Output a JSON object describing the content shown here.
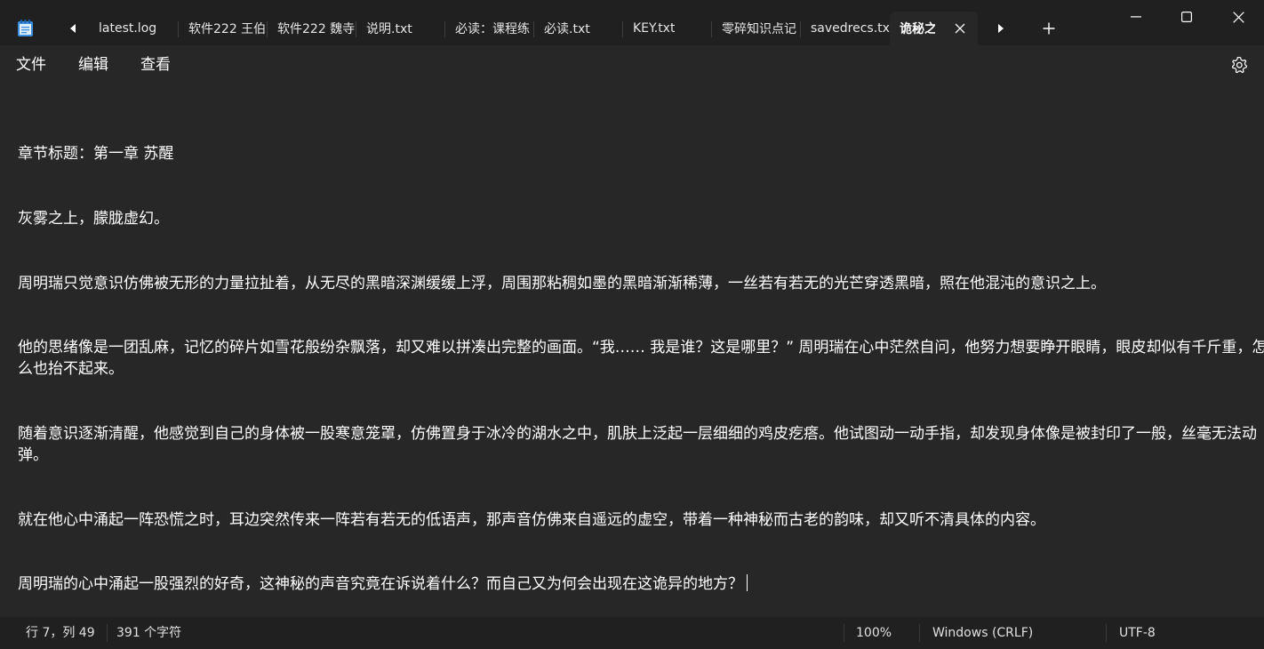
{
  "titlebar": {
    "tabs": [
      {
        "label": "latest.log"
      },
      {
        "label": "软件222 王伯"
      },
      {
        "label": "软件222 魏寺"
      },
      {
        "label": "说明.txt"
      },
      {
        "label": "必读：课程练"
      },
      {
        "label": "必读.txt"
      },
      {
        "label": "KEY.txt"
      },
      {
        "label": "零碎知识点记"
      },
      {
        "label": "savedrecs.txt"
      },
      {
        "label": "诡秘之"
      }
    ],
    "active_tab_index": 9
  },
  "menu": {
    "file": "文件",
    "edit": "编辑",
    "view": "查看"
  },
  "editor": {
    "lines": [
      "章节标题：第一章 苏醒",
      "灰雾之上，朦胧虚幻。",
      "周明瑞只觉意识仿佛被无形的力量拉扯着，从无尽的黑暗深渊缓缓上浮，周围那粘稠如墨的黑暗渐渐稀薄，一丝若有若无的光芒穿透黑暗，照在他混沌的意识之上。",
      "他的思绪像是一团乱麻，记忆的碎片如雪花般纷杂飘落，却又难以拼凑出完整的画面。“我…… 我是谁？这是哪里？” 周明瑞在心中茫然自问，他努力想要睁开眼睛，眼皮却似有千斤重，怎么也抬不起来。",
      "随着意识逐渐清醒，他感觉到自己的身体被一股寒意笼罩，仿佛置身于冰冷的湖水之中，肌肤上泛起一层细细的鸡皮疙瘩。他试图动一动手指，却发现身体像是被封印了一般，丝毫无法动弹。",
      "就在他心中涌起一阵恐慌之时，耳边突然传来一阵若有若无的低语声，那声音仿佛来自遥远的虚空，带着一种神秘而古老的韵味，却又听不清具体的内容。",
      "周明瑞的心中涌起一股强烈的好奇，这神秘的声音究竟在诉说着什么？而自己又为何会出现在这诡异的地方？"
    ]
  },
  "status": {
    "position": "行 7，列 49",
    "char_count": "391 个字符",
    "zoom": "100%",
    "line_ending": "Windows (CRLF)",
    "encoding": "UTF-8"
  },
  "icons": {
    "app": "notepad-icon",
    "scroll_left": "caret-left-icon",
    "scroll_right": "caret-right-icon",
    "close_tab": "close-icon",
    "new_tab": "plus-icon",
    "minimize": "minimize-icon",
    "maximize": "maximize-icon",
    "window_close": "close-icon",
    "settings": "gear-icon"
  },
  "colors": {
    "background": "#272727",
    "titlebar": "#202020",
    "text": "#ffffff",
    "app_icon_accent": "#3b8ee0"
  }
}
